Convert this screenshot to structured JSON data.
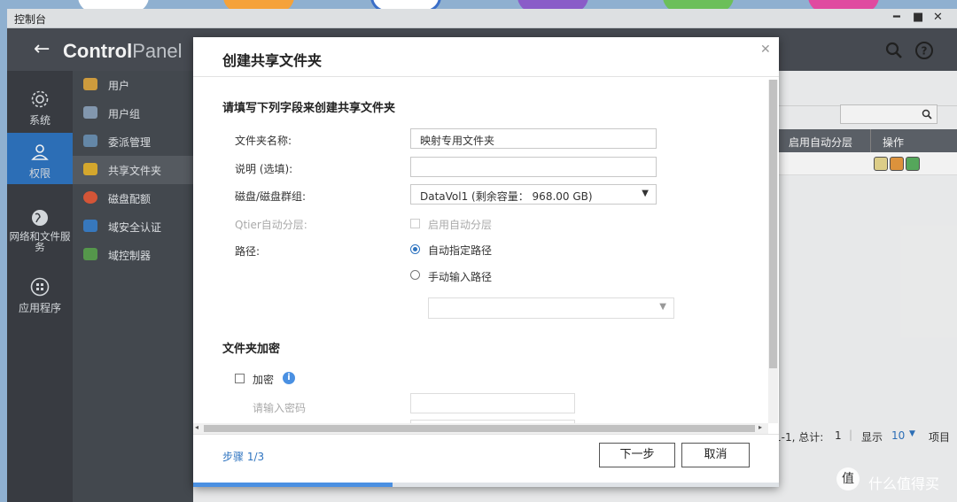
{
  "window": {
    "title": "控制台"
  },
  "header": {
    "app_title_bold": "Control",
    "app_title_light": "Panel"
  },
  "left_nav": [
    {
      "label": "系统",
      "icon": "gear-icon"
    },
    {
      "label": "权限",
      "icon": "user-icon"
    },
    {
      "label": "网络和文件服务",
      "icon": "globe-icon"
    },
    {
      "label": "应用程序",
      "icon": "apps-icon"
    }
  ],
  "sub_nav": [
    {
      "label": "用户",
      "color": "#d9a441"
    },
    {
      "label": "用户组",
      "color": "#8aa0b8"
    },
    {
      "label": "委派管理",
      "color": "#6a8fb0"
    },
    {
      "label": "共享文件夹",
      "color": "#e0b030"
    },
    {
      "label": "磁盘配额",
      "color": "#e05a3a"
    },
    {
      "label": "域安全认证",
      "color": "#3a7fc8"
    },
    {
      "label": "域控制器",
      "color": "#5aa050"
    }
  ],
  "table": {
    "col_auto_tier": "启用自动分层",
    "col_actions": "操作"
  },
  "pagination": {
    "range": "1-1, 总计:",
    "total": "1",
    "display": "显示",
    "per_page": "10",
    "items": "项目"
  },
  "dialog": {
    "title": "创建共享文件夹",
    "section_heading": "请填写下列字段来创建共享文件夹",
    "folder_name_label": "文件夹名称:",
    "folder_name_value": "映射专用文件夹",
    "description_label": "说明 (选填):",
    "description_value": "",
    "disk_label": "磁盘/磁盘群组:",
    "disk_value": "DataVol1 (剩余容量： 968.00 GB)",
    "qtier_label": "Qtier自动分层:",
    "qtier_option": "启用自动分层",
    "path_label": "路径:",
    "path_auto": "自动指定路径",
    "path_manual": "手动输入路径",
    "path_value": "",
    "encryption_heading": "文件夹加密",
    "encrypt_label": "加密",
    "password_placeholder": "请输入密码",
    "step": "步骤 1/3",
    "next": "下一步",
    "cancel": "取消",
    "progress": 0.34
  },
  "watermark": {
    "text": "什么值得买"
  },
  "colors": {
    "accent": "#2f74c0",
    "header": "#4a4f56",
    "nav": "#3b3f45"
  }
}
